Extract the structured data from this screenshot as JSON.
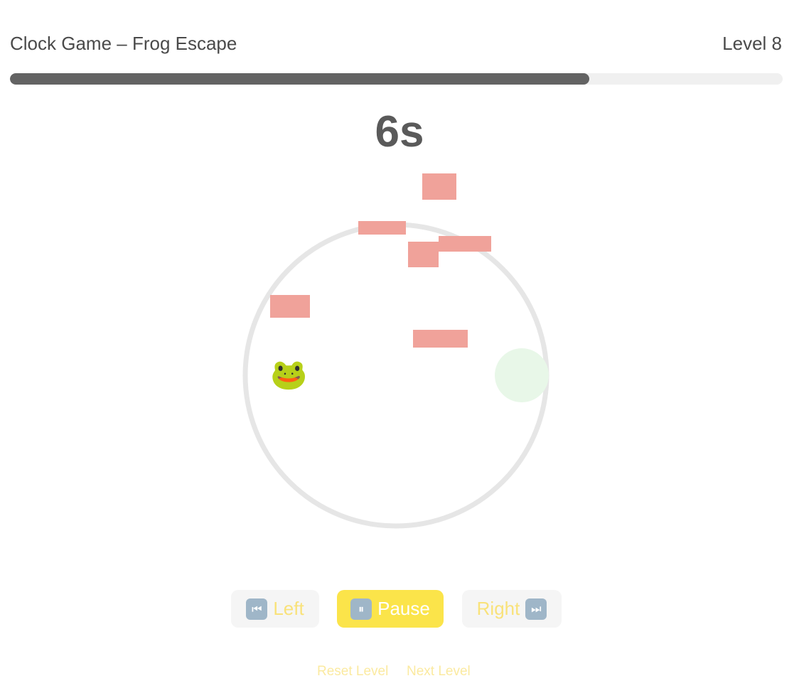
{
  "header": {
    "title": "Clock Game – Frog Escape",
    "level": "Level 8"
  },
  "timer": {
    "progress_fraction": 0.75,
    "remaining": "6s"
  },
  "game": {
    "player": {
      "icon": "frog-emoji",
      "glyph": "🐸"
    },
    "goal": {
      "color": "#e8f7e8"
    },
    "track": {
      "color": "#e6e6e6"
    },
    "obstacles": {
      "count": 6,
      "color": "#f0a29a"
    }
  },
  "controls": {
    "left": {
      "icon": "skip-back-icon",
      "glyph": "⏮",
      "label": "Left"
    },
    "pause": {
      "icon": "pause-icon",
      "glyph": "⏸",
      "label": "Pause"
    },
    "right": {
      "icon": "skip-forward-icon",
      "glyph": "⏭",
      "label": "Right"
    }
  },
  "links": {
    "reset": "Reset Level",
    "next": "Next Level"
  }
}
